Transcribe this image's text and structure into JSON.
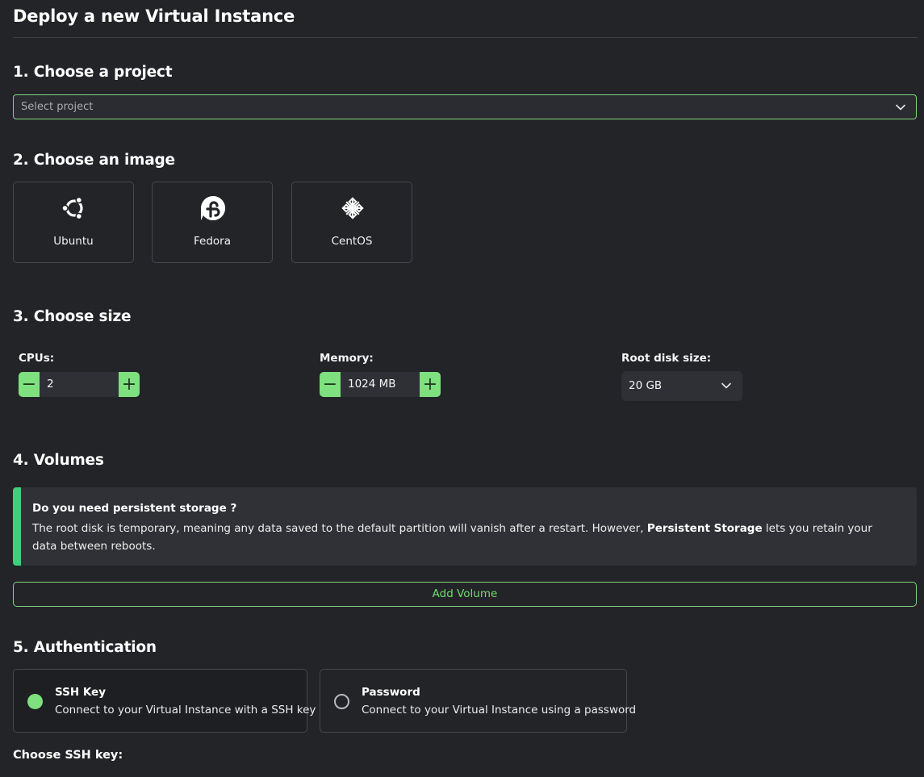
{
  "page": {
    "title": "Deploy a new Virtual Instance"
  },
  "project": {
    "heading": "1. Choose a project",
    "placeholder": "Select project"
  },
  "image": {
    "heading": "2. Choose an image",
    "options": [
      {
        "label": "Ubuntu",
        "icon": "ubuntu-icon"
      },
      {
        "label": "Fedora",
        "icon": "fedora-icon"
      },
      {
        "label": "CentOS",
        "icon": "centos-icon"
      }
    ]
  },
  "size": {
    "heading": "3. Choose size",
    "cpus": {
      "label": "CPUs:",
      "value": "2",
      "decrement": "−",
      "increment": "+"
    },
    "memory": {
      "label": "Memory:",
      "value": "1024 MB",
      "decrement": "−",
      "increment": "+"
    },
    "disk": {
      "label": "Root disk size:",
      "value": "20 GB"
    }
  },
  "volumes": {
    "heading": "4. Volumes",
    "notice_title": "Do you need persistent storage ?",
    "notice_body_pre": "The root disk is temporary, meaning any data saved to the default partition will vanish after a restart. However, ",
    "notice_body_bold": "Persistent Storage",
    "notice_body_post": " lets you retain your data between reboots.",
    "add_button": "Add Volume"
  },
  "auth": {
    "heading": "5. Authentication",
    "options": [
      {
        "title": "SSH Key",
        "desc": "Connect to your Virtual Instance with a SSH key",
        "selected": true
      },
      {
        "title": "Password",
        "desc": "Connect to your Virtual Instance using a password",
        "selected": false
      }
    ],
    "ssh_key_label": "Choose SSH key:"
  },
  "colors": {
    "accent": "#7ee07e",
    "notice_bar": "#3fcf7d",
    "background": "#232428"
  }
}
